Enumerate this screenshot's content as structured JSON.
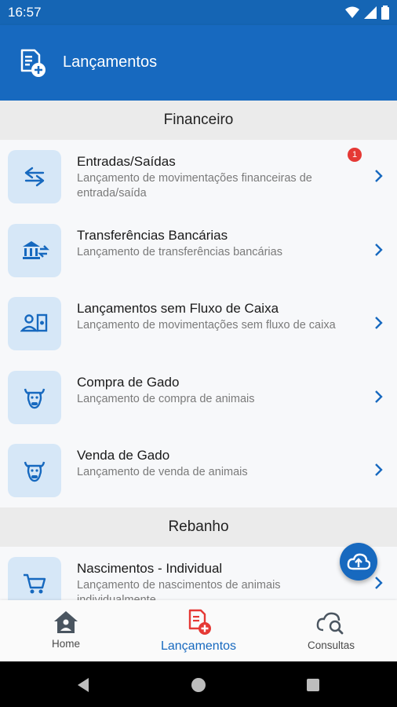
{
  "status": {
    "time": "16:57"
  },
  "app_bar": {
    "title": "Lançamentos"
  },
  "sections": [
    {
      "title": "Financeiro"
    },
    {
      "title": "Rebanho"
    }
  ],
  "rows": [
    {
      "title": "Entradas/Saídas",
      "sub": "Lançamento de movimentações financeiras de entrada/saída",
      "badge": "1"
    },
    {
      "title": "Transferências Bancárias",
      "sub": "Lançamento de transferências bancárias"
    },
    {
      "title": "Lançamentos sem Fluxo de Caixa",
      "sub": "Lançamento de movimentações sem fluxo de caixa"
    },
    {
      "title": "Compra de Gado",
      "sub": "Lançamento de compra de animais"
    },
    {
      "title": "Venda de Gado",
      "sub": "Lançamento de venda de animais"
    },
    {
      "title": "Nascimentos - Individual",
      "sub": "Lançamento de nascimentos de animais individualmente"
    }
  ],
  "nav": [
    {
      "label": "Home"
    },
    {
      "label": "Lançamentos"
    },
    {
      "label": "Consultas"
    }
  ],
  "colors": {
    "primary": "#1769bf",
    "badge": "#e53935",
    "accent_active": "#e53935",
    "tile": "#d6e7f7"
  }
}
